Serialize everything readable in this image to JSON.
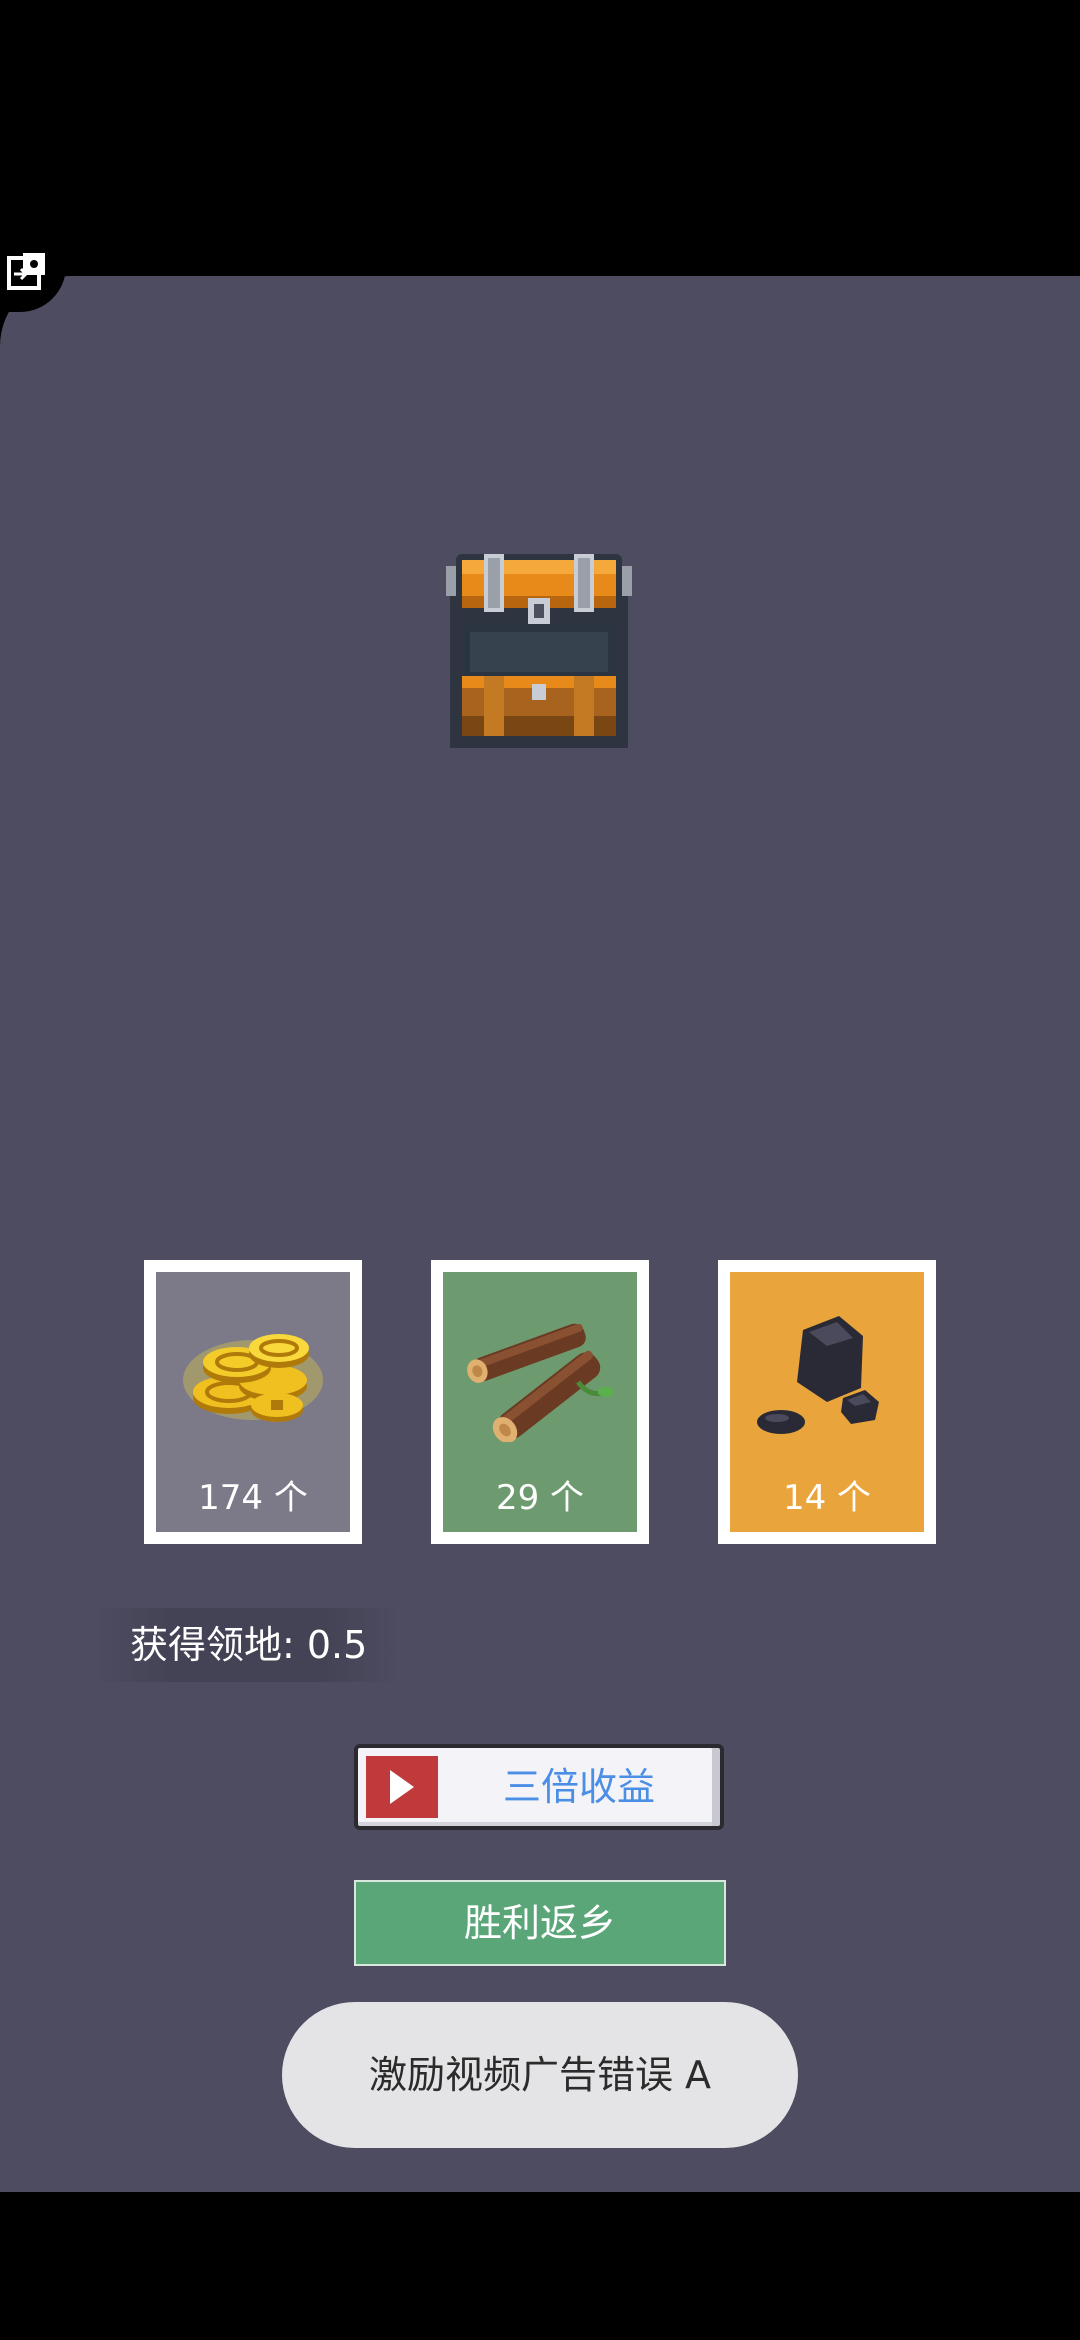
{
  "game": {
    "corner_icon": "puzzle-exit-icon",
    "chest_icon": "treasure-chest-icon",
    "rewards": [
      {
        "icon": "gold-coins-icon",
        "count": "174 个",
        "color": "#7c7a88"
      },
      {
        "icon": "wood-logs-icon",
        "count": "29 个",
        "color": "#6e9a70"
      },
      {
        "icon": "coal-stone-icon",
        "count": "14 个",
        "color": "#e9a43b"
      }
    ],
    "territory_label": "获得领地: 0.5",
    "triple_button_label": "三倍收益",
    "triple_button_icon": "play-video-icon",
    "return_button_label": "胜利返乡",
    "toast_message": "激励视频广告错误 A"
  },
  "colors": {
    "background": "#4e4c60",
    "return_button": "#5aa679",
    "triple_label": "#4a8ee6",
    "play_box": "#c0393b"
  }
}
